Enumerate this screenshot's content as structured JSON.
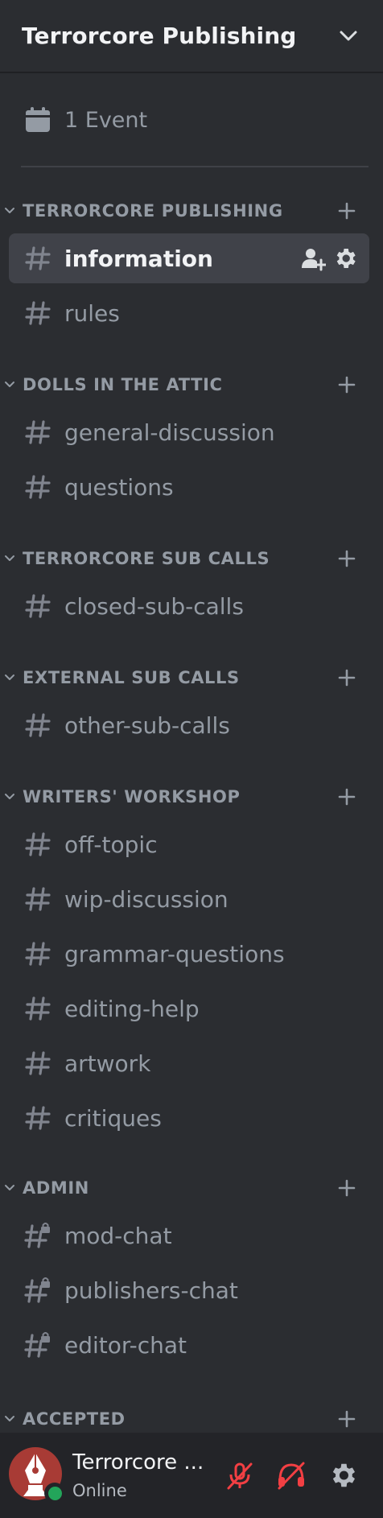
{
  "server": {
    "name": "Terrorcore Publishing"
  },
  "events": {
    "label": "1 Event"
  },
  "categories": [
    {
      "name": "TERRORCORE PUBLISHING",
      "channels": [
        {
          "name": "information",
          "active": true,
          "locked": false
        },
        {
          "name": "rules",
          "active": false,
          "locked": false
        }
      ]
    },
    {
      "name": "DOLLS IN THE ATTIC",
      "channels": [
        {
          "name": "general-discussion",
          "active": false,
          "locked": false
        },
        {
          "name": "questions",
          "active": false,
          "locked": false
        }
      ]
    },
    {
      "name": "TERRORCORE SUB CALLS",
      "channels": [
        {
          "name": "closed-sub-calls",
          "active": false,
          "locked": false
        }
      ]
    },
    {
      "name": "EXTERNAL SUB CALLS",
      "channels": [
        {
          "name": "other-sub-calls",
          "active": false,
          "locked": false
        }
      ]
    },
    {
      "name": "WRITERS' WORKSHOP",
      "channels": [
        {
          "name": "off-topic",
          "active": false,
          "locked": false
        },
        {
          "name": "wip-discussion",
          "active": false,
          "locked": false
        },
        {
          "name": "grammar-questions",
          "active": false,
          "locked": false
        },
        {
          "name": "editing-help",
          "active": false,
          "locked": false
        },
        {
          "name": "artwork",
          "active": false,
          "locked": false
        },
        {
          "name": "critiques",
          "active": false,
          "locked": false
        }
      ]
    },
    {
      "name": "ADMIN",
      "channels": [
        {
          "name": "mod-chat",
          "active": false,
          "locked": true
        },
        {
          "name": "publishers-chat",
          "active": false,
          "locked": true
        },
        {
          "name": "editor-chat",
          "active": false,
          "locked": true
        }
      ]
    },
    {
      "name": "ACCEPTED",
      "channels": []
    }
  ],
  "user": {
    "name": "Terrorcore ...",
    "status": "Online"
  },
  "colors": {
    "background": "#2b2d31",
    "active_row": "#404249",
    "user_panel": "#232428",
    "muted_red": "#f23f43",
    "online_green": "#23a55a",
    "avatar_red": "#a83b35"
  },
  "icons": {
    "header": "chevron-down-icon",
    "events": "calendar-icon",
    "channel": "hash-icon",
    "locked_channel": "locked-hash-icon",
    "category_toggle": "chevron-down-icon",
    "category_add": "plus-icon",
    "invite": "add-member-icon",
    "settings": "gear-icon",
    "mic": "mic-muted-icon",
    "headphones": "headphones-deafened-icon"
  }
}
